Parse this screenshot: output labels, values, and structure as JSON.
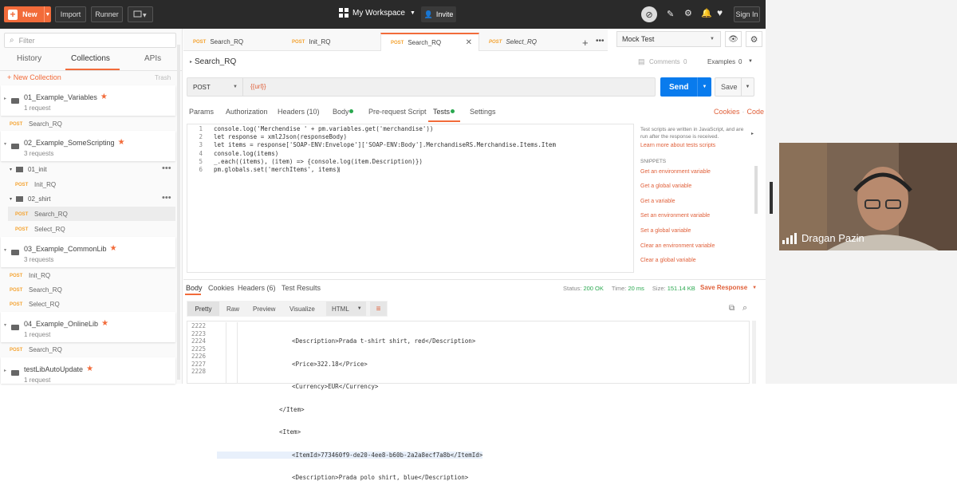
{
  "topbar": {
    "new_label": "New",
    "import_label": "Import",
    "runner_label": "Runner",
    "workspace_label": "My Workspace",
    "invite_label": "Invite",
    "signin_label": "Sign In"
  },
  "sidebar": {
    "filter_placeholder": "Filter",
    "tabs": [
      "History",
      "Collections",
      "APIs"
    ],
    "active_tab": "Collections",
    "new_collection_label": "+ New Collection",
    "trash_label": "Trash",
    "collections": [
      {
        "name": "01_Example_Variables",
        "count": "1 request"
      },
      {
        "name": "02_Example_SomeScripting",
        "count": "3 requests"
      },
      {
        "name": "03_Example_CommonLib",
        "count": "3 requests"
      },
      {
        "name": "04_Example_OnlineLib",
        "count": "1 request"
      },
      {
        "name": "testLibAutoUpdate",
        "count": "1 request"
      }
    ],
    "folders": [
      "01_init",
      "02_shirt"
    ],
    "requests": {
      "c1": [
        "Search_RQ"
      ],
      "f1": [
        "Init_RQ"
      ],
      "f2": [
        "Search_RQ",
        "Select_RQ"
      ],
      "c3": [
        "Init_RQ",
        "Search_RQ",
        "Select_RQ"
      ],
      "c4": [
        "Search_RQ"
      ]
    },
    "method": "POST"
  },
  "tabs": [
    {
      "method": "POST",
      "name": "Search_RQ"
    },
    {
      "method": "POST",
      "name": "Init_RQ"
    },
    {
      "method": "POST",
      "name": "Search_RQ"
    },
    {
      "method": "POST",
      "name": "Select_RQ"
    }
  ],
  "environment": "Mock Test",
  "request": {
    "title": "Search_RQ",
    "comments_label": "Comments",
    "comments_count": "0",
    "examples_label": "Examples",
    "examples_count": "0",
    "method": "POST",
    "url": "{{url}}",
    "send_label": "Send",
    "save_label": "Save",
    "tabs": [
      "Params",
      "Authorization",
      "Headers (10)",
      "Body",
      "Pre-request Script",
      "Tests",
      "Settings"
    ],
    "cookies_label": "Cookies",
    "code_label": "Code"
  },
  "code_lines": [
    "console.log('Merchendise ' + pm.variables.get('merchandise'))",
    "let response = xml2Json(responseBody)",
    "let items = response['SOAP-ENV:Envelope']['SOAP-ENV:Body'].MerchandiseRS.Merchandise.Items.Item",
    "console.log(items)",
    "_.each((items), (item) => {console.log(item.Description)})",
    "pm.globals.set('merchItems', items)"
  ],
  "snippets": {
    "help": "Test scripts are written in JavaScript, and are run after the response is received.",
    "learn_more": "Learn more about tests scripts",
    "heading": "SNIPPETS",
    "items": [
      "Get an environment variable",
      "Get a global variable",
      "Get a variable",
      "Set an environment variable",
      "Set a global variable",
      "Clear an environment variable",
      "Clear a global variable"
    ]
  },
  "response": {
    "tabs": [
      "Body",
      "Cookies",
      "Headers (6)",
      "Test Results"
    ],
    "status_label": "Status:",
    "status": "200 OK",
    "time_label": "Time:",
    "time": "20 ms",
    "size_label": "Size:",
    "size": "151.14 KB",
    "save_response": "Save Response",
    "views": [
      "Pretty",
      "Raw",
      "Preview",
      "Visualize"
    ],
    "format": "HTML",
    "line_numbers": [
      "2222",
      "2223",
      "2224",
      "2225",
      "2226",
      "2227",
      "2228"
    ],
    "lines": [
      "<Description>Prada t-shirt shirt, red</Description>",
      "<Price>322.18</Price>",
      "<Currency>EUR</Currency>",
      "</Item>",
      "<Item>",
      "<ItemId>773460f9-de20-4ee8-b60b-2a2a8ecf7a8b</ItemId>",
      "<Description>Prada polo shirt, blue</Description>"
    ]
  },
  "video": {
    "participant": "Dragan Pazin"
  },
  "colors": {
    "accent": "#f26b3a",
    "send": "#097bed",
    "topbar": "#2a2a2a"
  }
}
